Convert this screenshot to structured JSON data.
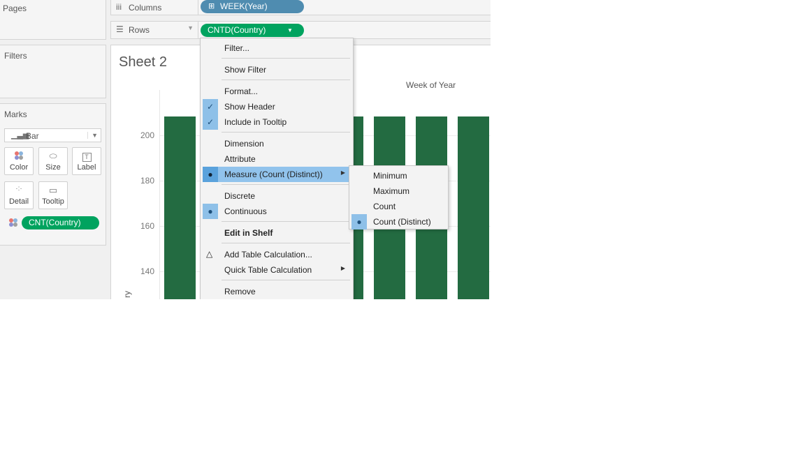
{
  "left_panels": {
    "pages_title": "Pages",
    "filters_title": "Filters",
    "marks_title": "Marks"
  },
  "marks": {
    "type_value": "Bar",
    "buttons": [
      {
        "label": "Color",
        "icon": "color-dots-icon"
      },
      {
        "label": "Size",
        "icon": "size-icon"
      },
      {
        "label": "Label",
        "icon": "label-icon"
      },
      {
        "label": "Detail",
        "icon": "detail-icon"
      },
      {
        "label": "Tooltip",
        "icon": "tooltip-icon"
      }
    ],
    "color_pill": "CNT(Country)"
  },
  "shelves": {
    "columns_label": "Columns",
    "rows_label": "Rows",
    "columns_pill": "WEEK(Year)",
    "rows_pill": "CNTD(Country)"
  },
  "sheet": {
    "title": "Sheet 2",
    "column_header": "Week of Year",
    "y_axis_label_fragment": "ry",
    "y_ticks": [
      "200",
      "180",
      "160",
      "140"
    ]
  },
  "context_menu": {
    "items": [
      {
        "label": "Filter..."
      },
      {
        "label": "Show Filter"
      },
      {
        "label": "Format..."
      },
      {
        "label": "Show Header",
        "checked": true
      },
      {
        "label": "Include in Tooltip",
        "checked": true
      },
      {
        "label": "Dimension"
      },
      {
        "label": "Attribute"
      },
      {
        "label": "Measure (Count (Distinct))",
        "selected": true,
        "submenu": true
      },
      {
        "label": "Discrete"
      },
      {
        "label": "Continuous",
        "selected": true
      },
      {
        "label": "Edit in Shelf",
        "bold": true
      },
      {
        "label": "Add Table Calculation...",
        "icon": "delta-icon"
      },
      {
        "label": "Quick Table Calculation",
        "submenu": true
      },
      {
        "label": "Remove"
      }
    ]
  },
  "submenu": {
    "items": [
      {
        "label": "Minimum"
      },
      {
        "label": "Maximum"
      },
      {
        "label": "Count"
      },
      {
        "label": "Count (Distinct)",
        "selected": true
      }
    ]
  },
  "colors": {
    "bar": "#236b41",
    "rows_pill": "#00a35f",
    "columns_pill": "#4f8cb0",
    "menu_highlight": "#91c3ec"
  }
}
